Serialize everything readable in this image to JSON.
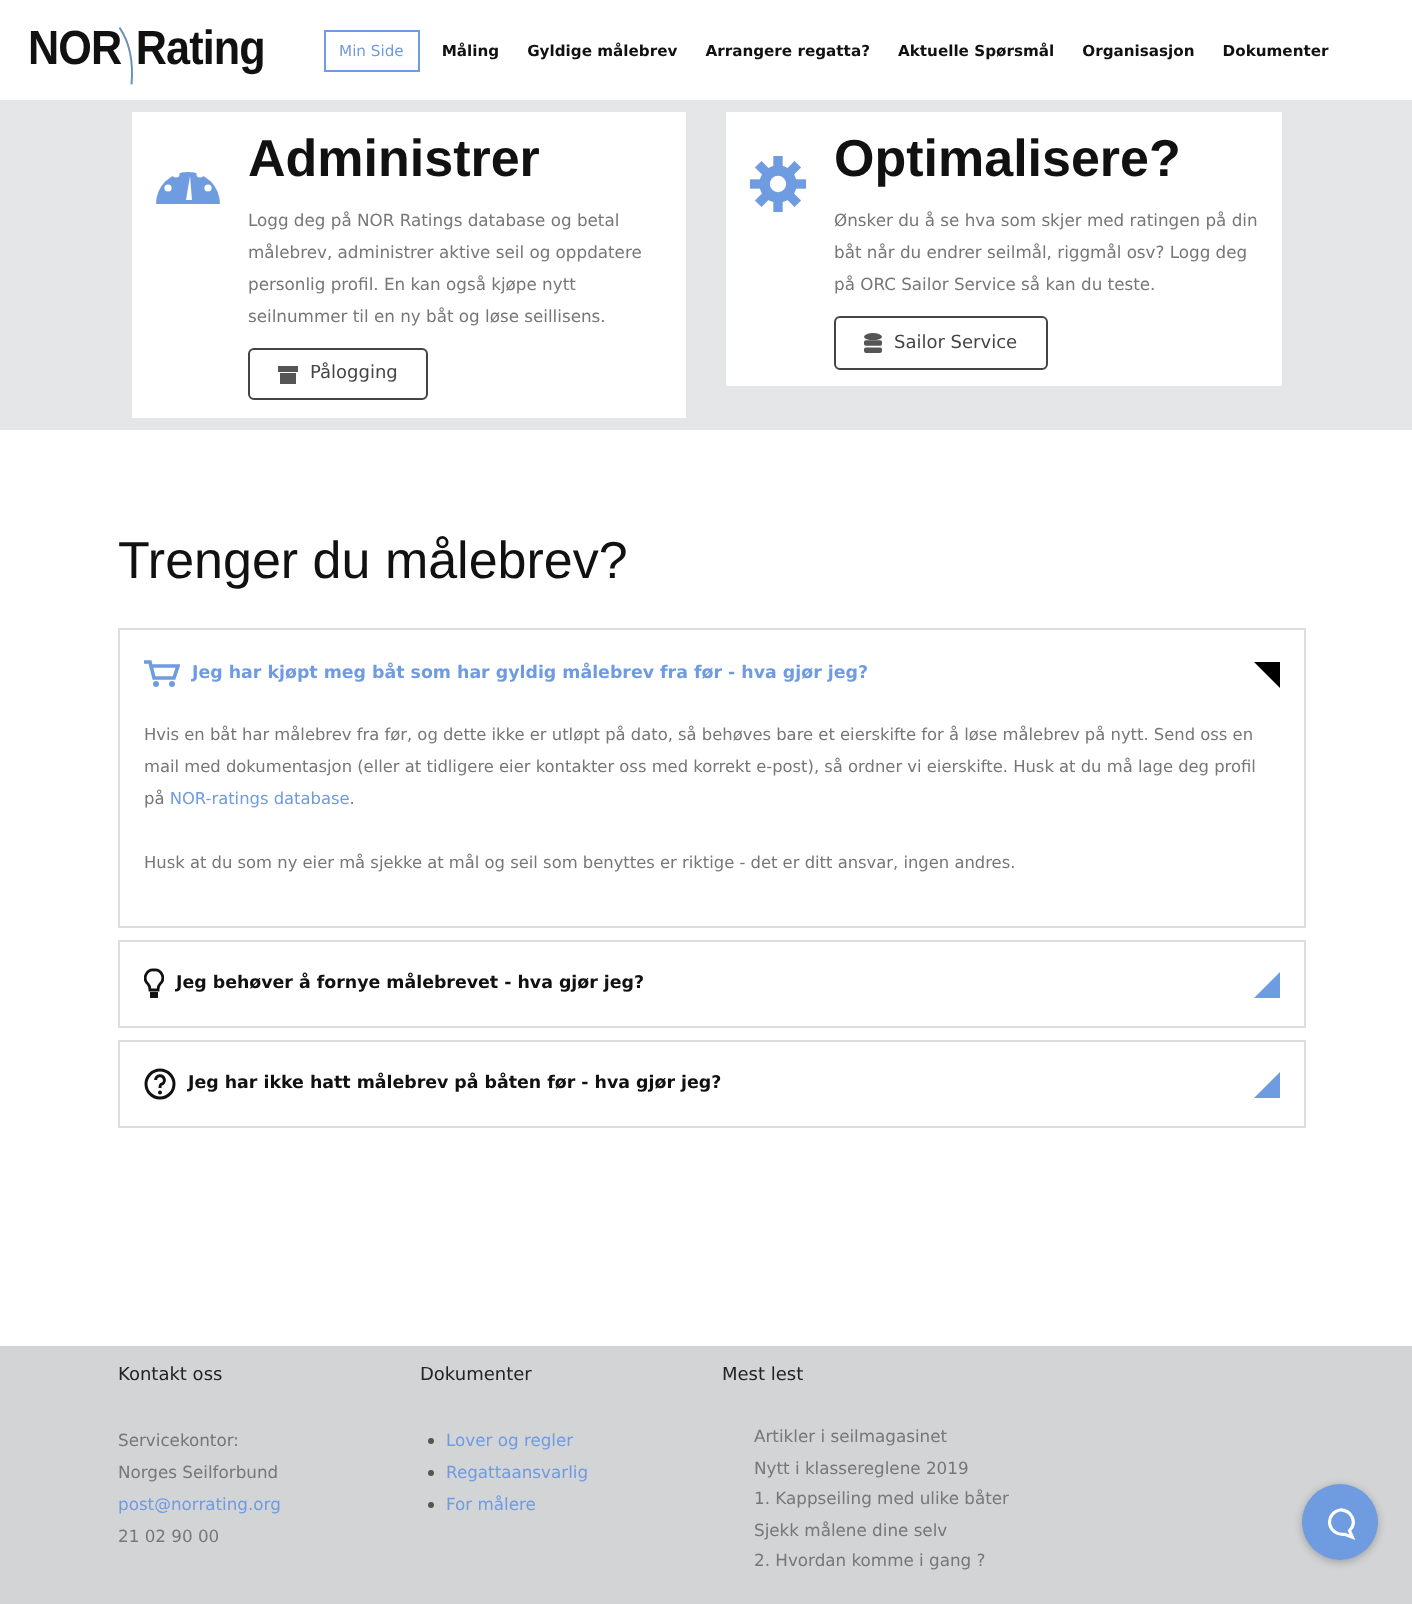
{
  "logo": {
    "left": "NOR",
    "right": "Rating"
  },
  "nav": [
    {
      "label": "Min Side",
      "selected": true
    },
    {
      "label": "Måling",
      "selected": false
    },
    {
      "label": "Gyldige målebrev",
      "selected": false
    },
    {
      "label": "Arrangere regatta?",
      "selected": false
    },
    {
      "label": "Aktuelle Spørsmål",
      "selected": false
    },
    {
      "label": "Organisasjon",
      "selected": false
    },
    {
      "label": "Dokumenter",
      "selected": false
    }
  ],
  "cards": [
    {
      "title": "Administrer",
      "text": "Logg deg på NOR Ratings database og betal målebrev, administrer aktive seil og oppdatere personlig profil. En kan også kjøpe nytt seilnummer til en ny båt og løse seillisens.",
      "button": "Pålogging"
    },
    {
      "title": "Optimalisere?",
      "text": "Ønsker du å se hva som skjer med ratingen på din båt når du endrer seilmål, riggmål osv? Logg deg på ORC Sailor Service så kan du teste.",
      "button": "Sailor Service"
    }
  ],
  "heading": "Trenger du målebrev?",
  "accordion": [
    {
      "title": "Jeg har kjøpt meg båt som har gyldig målebrev fra før - hva gjør jeg?",
      "expanded": true,
      "body": [
        {
          "text": "Hvis en båt har målebrev fra før, og dette ikke er utløpt på dato, så behøves bare et eierskifte for å løse målebrev på nytt. Send oss en mail med dokumentasjon (eller at tidligere eier kontakter oss med korrekt e-post), så ordner vi eierskifte. Husk at du må lage deg profil på",
          "link": "NOR-ratings database",
          "after": "."
        },
        {
          "text": "Husk at du som ny eier må sjekke at mål og seil som benyttes er riktige - det er ditt ansvar, ingen andres."
        }
      ]
    },
    {
      "title": "Jeg behøver å fornye målebrevet - hva gjør jeg?",
      "expanded": false
    },
    {
      "title": "Jeg har ikke hatt målebrev på båten før - hva gjør jeg?",
      "expanded": false
    }
  ],
  "footer": {
    "contact": {
      "title": "Kontakt oss",
      "lines": [
        {
          "kind": "text",
          "text": "Servicekontor:"
        },
        {
          "kind": "text",
          "text": "Norges Seilforbund"
        },
        {
          "kind": "link",
          "text": "post@norrating.org"
        },
        {
          "kind": "text",
          "text": "21 02 90 00"
        }
      ]
    },
    "documents": {
      "title": "Dokumenter",
      "links": [
        "Lover og regler",
        "Regattaansvarlig",
        "For målere"
      ]
    },
    "popular": {
      "title": "Mest lest",
      "items": [
        "Artikler i seilmagasinet",
        "Nytt i klassereglene 2019",
        "1. Kappseiling med ulike båter",
        "Sjekk målene dine selv",
        "2. Hvordan komme i gang ?"
      ]
    }
  }
}
